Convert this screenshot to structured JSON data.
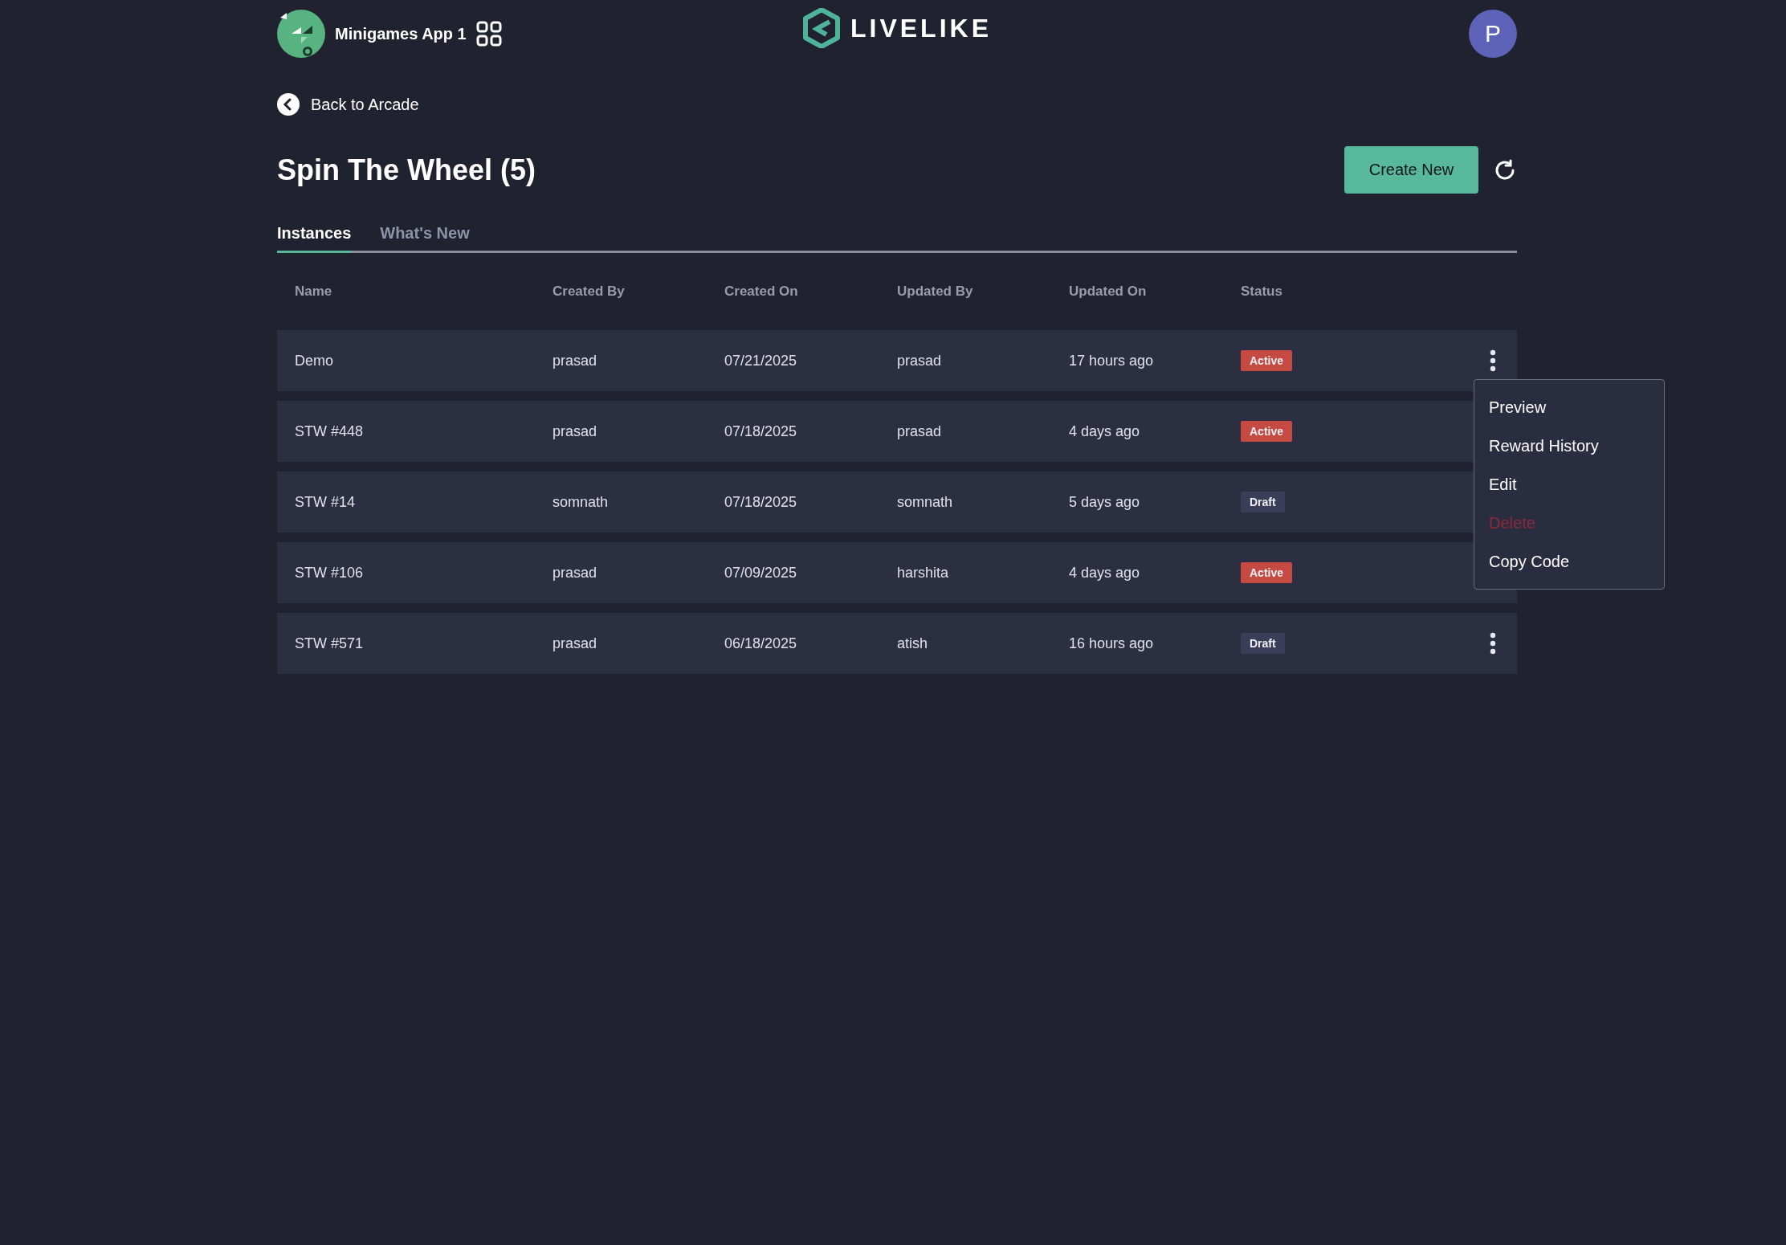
{
  "header": {
    "app_name": "Minigames App 1",
    "logo_text": "LIVELIKE",
    "avatar_letter": "P"
  },
  "back_link": "Back to Arcade",
  "title": "Spin The Wheel (5)",
  "create_button": "Create New",
  "tabs": [
    {
      "label": "Instances",
      "selected": true
    },
    {
      "label": "What's New",
      "selected": false
    }
  ],
  "table": {
    "columns": [
      "Name",
      "Created By",
      "Created On",
      "Updated By",
      "Updated On",
      "Status"
    ],
    "rows": [
      {
        "cells": [
          "Demo",
          "prasad",
          "07/21/2025",
          "prasad",
          "17 hours ago"
        ],
        "status": {
          "label": "Active",
          "kind": "active"
        },
        "menu": [
          {
            "label": "Preview",
            "disabled": false
          },
          {
            "label": "Reward History",
            "disabled": false
          },
          {
            "label": "Edit",
            "disabled": false
          },
          {
            "label": "Delete",
            "disabled": true
          },
          {
            "label": "Copy Code",
            "disabled": false
          }
        ]
      },
      {
        "cells": [
          "STW #448",
          "prasad",
          "07/18/2025",
          "prasad",
          "4 days ago"
        ],
        "status": {
          "label": "Active",
          "kind": "active"
        }
      },
      {
        "cells": [
          "STW #14",
          "somnath",
          "07/18/2025",
          "somnath",
          "5 days ago"
        ],
        "status": {
          "label": "Draft",
          "kind": "draft"
        }
      },
      {
        "cells": [
          "STW #106",
          "prasad",
          "07/09/2025",
          "harshita",
          "4 days ago"
        ],
        "status": {
          "label": "Active",
          "kind": "active"
        }
      },
      {
        "cells": [
          "STW #571",
          "prasad",
          "06/18/2025",
          "atish",
          "16 hours ago"
        ],
        "status": {
          "label": "Draft",
          "kind": "draft"
        }
      }
    ]
  }
}
